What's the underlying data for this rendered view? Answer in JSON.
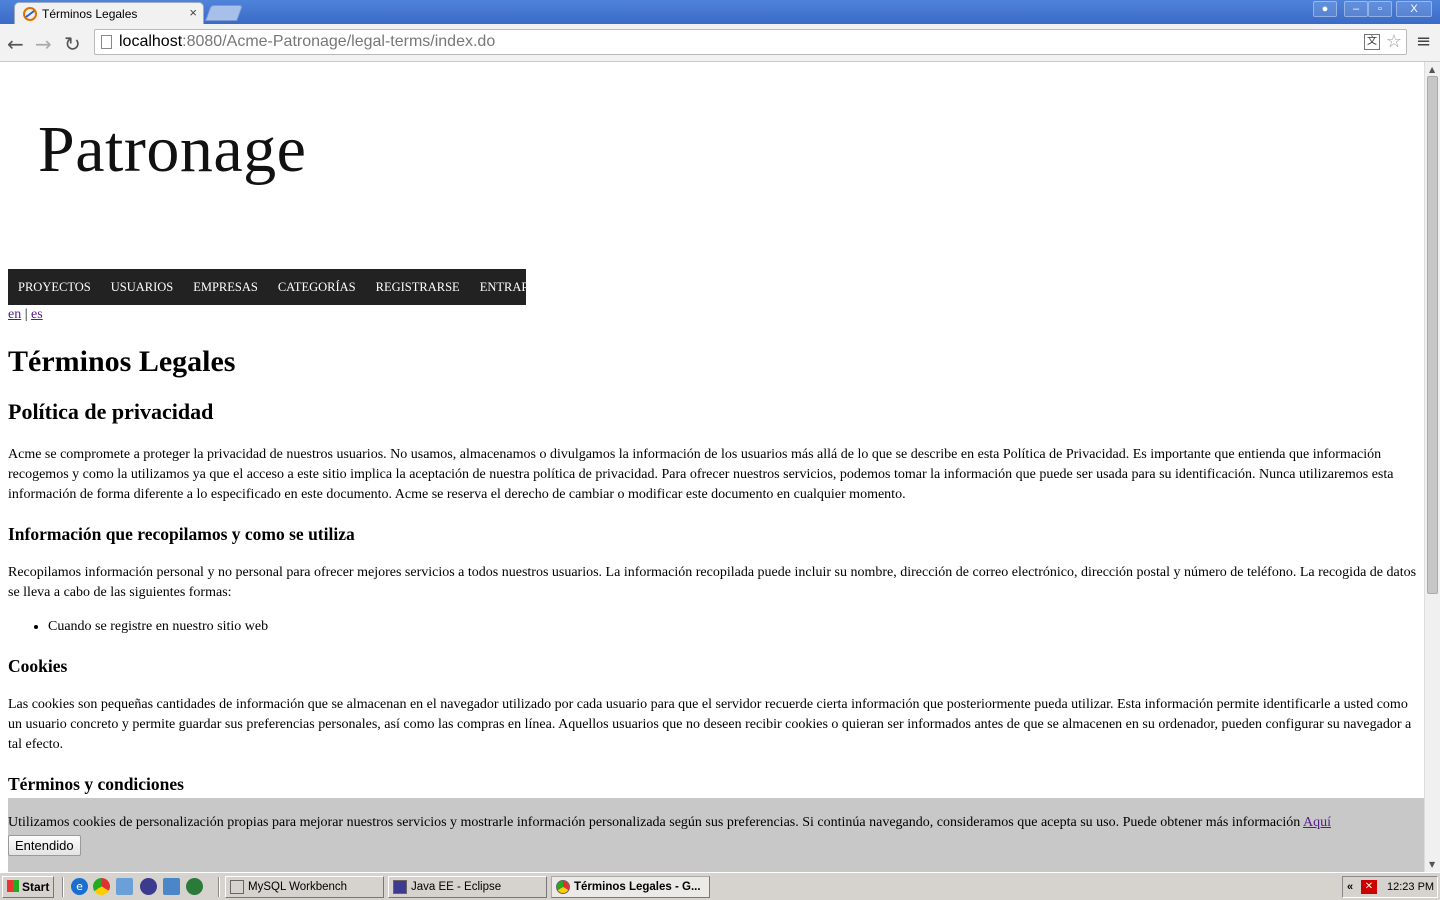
{
  "browser": {
    "tab_title": "Términos Legales",
    "tab_close": "×",
    "url_host": "localhost",
    "url_rest": ":8080/Acme-Patronage/legal-terms/index.do",
    "window_buttons": {
      "user": "●",
      "minimize": "–",
      "maximize": "▫",
      "close": "X"
    },
    "nav": {
      "back": "←",
      "forward": "→",
      "reload": "↻",
      "menu": "≡",
      "star": "☆",
      "translate": "文"
    }
  },
  "page": {
    "logo": "Patronage",
    "menu": [
      "PROYECTOS",
      "USUARIOS",
      "EMPRESAS",
      "CATEGORÍAS",
      "REGISTRARSE",
      "ENTRAR"
    ],
    "lang": {
      "en": "en",
      "sep": "|",
      "es": "es"
    },
    "title": "Términos Legales",
    "privacy_heading": "Política de privacidad",
    "privacy_text": "Acme se compromete a proteger la privacidad de nuestros usuarios. No usamos, almacenamos o divulgamos la información de los usuarios más allá de lo que se describe en esta Política de Privacidad. Es importante que entienda que información recogemos y como la utilizamos ya que el acceso a este sitio implica la aceptación de nuestra política de privacidad. Para ofrecer nuestros servicios, podemos tomar la información que puede ser usada para su identificación. Nunca utilizaremos esta información de forma diferente a lo especificado en este documento. Acme se reserva el derecho de cambiar o modificar este documento en cualquier momento.",
    "info_heading": "Información que recopilamos y como se utiliza",
    "info_text": "Recopilamos información personal y no personal para ofrecer mejores servicios a todos nuestros usuarios. La información recopilada puede incluir su nombre, dirección de correo electrónico, dirección postal y número de teléfono. La recogida de datos se lleva a cabo de las siguientes formas:",
    "info_list": [
      "Cuando se registre en nuestro sitio web"
    ],
    "cookies_heading": "Cookies",
    "cookies_text": "Las cookies son pequeñas cantidades de información que se almacenan en el navegador utilizado por cada usuario para que el servidor recuerde cierta información que posteriormente pueda utilizar. Esta información permite identificarle a usted como un usuario concreto y permite guardar sus preferencias personales, así como las compras en línea. Aquellos usuarios que no deseen recibir cookies o quieran ser informados antes de que se almacenen en su ordenador, pueden configurar su navegador a tal efecto.",
    "next_heading": "Términos y condiciones"
  },
  "cookie_banner": {
    "text": "Utilizamos cookies de personalización propias para mejorar nuestros servicios y mostrarle información personalizada según sus preferencias. Si continúa navegando, consideramos que acepta su uso. Puede obtener más información ",
    "link": "Aquí",
    "button": "Entendido"
  },
  "taskbar": {
    "start": "Start",
    "tasks": [
      "MySQL Workbench",
      "Java EE - Eclipse",
      "Términos Legales - G..."
    ],
    "tray_chevron": "«",
    "clock": "12:23 PM"
  },
  "colors": {
    "titlebar": "#3a6bc7",
    "nav_bg": "#222222",
    "banner_bg": "#c8c8c8",
    "link": "#551a8b"
  }
}
